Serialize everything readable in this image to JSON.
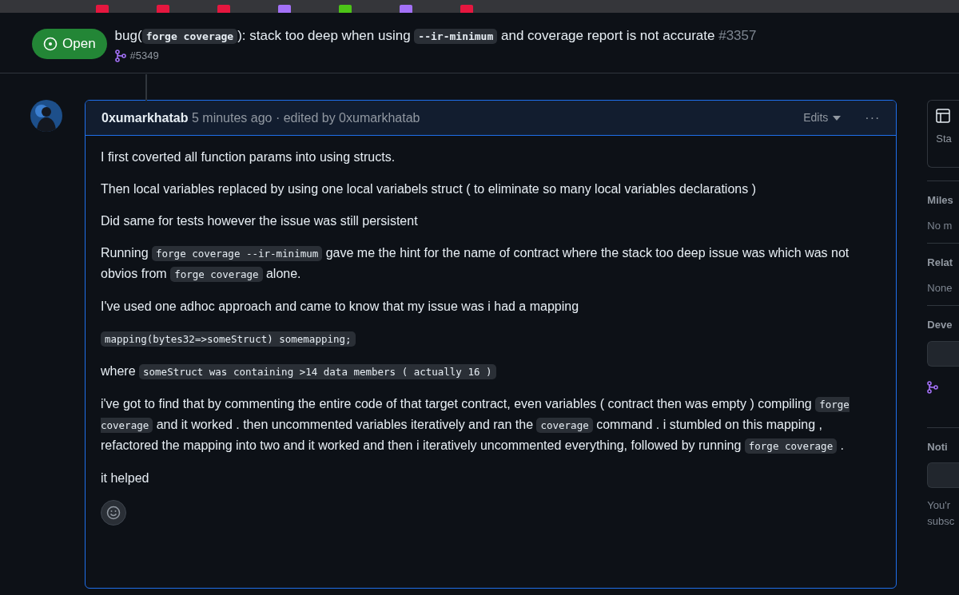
{
  "issue": {
    "state": "Open",
    "title": [
      {
        "kind": "text",
        "text": "bug("
      },
      {
        "kind": "code",
        "text": "forge coverage"
      },
      {
        "kind": "text",
        "text": "): stack too deep when using "
      },
      {
        "kind": "code",
        "text": "--ir-minimum"
      },
      {
        "kind": "text",
        "text": " and coverage report is not accurate"
      }
    ],
    "number": "#3357",
    "linked_pr": "#5349"
  },
  "comment": {
    "author": "0xumarkhatab",
    "time": "5 minutes ago",
    "edited": "· edited by 0xumarkhatab",
    "edits_label": "Edits",
    "more": "···",
    "paragraphs": [
      [
        {
          "kind": "text",
          "text": "I first coverted all function params into using structs."
        }
      ],
      [
        {
          "kind": "text",
          "text": "Then local variables replaced by using one local variabels struct ( to eliminate so many local variables declarations )"
        }
      ],
      [
        {
          "kind": "text",
          "text": "Did same for tests however the issue was still persistent"
        }
      ],
      [
        {
          "kind": "text",
          "text": "Running "
        },
        {
          "kind": "code",
          "text": "forge coverage --ir-minimum"
        },
        {
          "kind": "text",
          "text": " gave me the hint for the name of contract where the stack too deep issue was which was not obvios from "
        },
        {
          "kind": "code",
          "text": "forge coverage"
        },
        {
          "kind": "text",
          "text": " alone."
        }
      ],
      [
        {
          "kind": "text",
          "text": "I've used one adhoc approach and came to know that my issue was i had a mapping"
        }
      ],
      [
        {
          "kind": "code",
          "text": "mapping(bytes32=>someStruct) somemapping;"
        }
      ],
      [
        {
          "kind": "text",
          "text": "where "
        },
        {
          "kind": "code",
          "text": "someStruct was containing >14 data members ( actually 16 )"
        }
      ],
      [
        {
          "kind": "text",
          "text": "i've got to find that by commenting the entire code of that target contract, even variables ( contract then was empty ) compiling "
        },
        {
          "kind": "code",
          "text": "forge coverage"
        },
        {
          "kind": "text",
          "text": " and it worked . then uncommented variables iteratively and ran the "
        },
        {
          "kind": "code",
          "text": "coverage"
        },
        {
          "kind": "text",
          "text": " command . i stumbled on this mapping , refactored the mapping into two and it worked and then i iteratively uncommented everything, followed by running "
        },
        {
          "kind": "code",
          "text": "forge coverage"
        },
        {
          "kind": "text",
          "text": " ."
        }
      ],
      [
        {
          "kind": "text",
          "text": "it helped"
        }
      ]
    ]
  },
  "sidebar": {
    "sections": [
      {
        "kind": "card",
        "title": "Sta"
      },
      {
        "kind": "heading",
        "title": "Miles",
        "value": "No m"
      },
      {
        "kind": "heading",
        "title": "Relat",
        "value": "None"
      },
      {
        "kind": "dev",
        "title": "Deve"
      },
      {
        "kind": "notify",
        "title": "Noti",
        "value": "You'r subsc"
      }
    ]
  }
}
